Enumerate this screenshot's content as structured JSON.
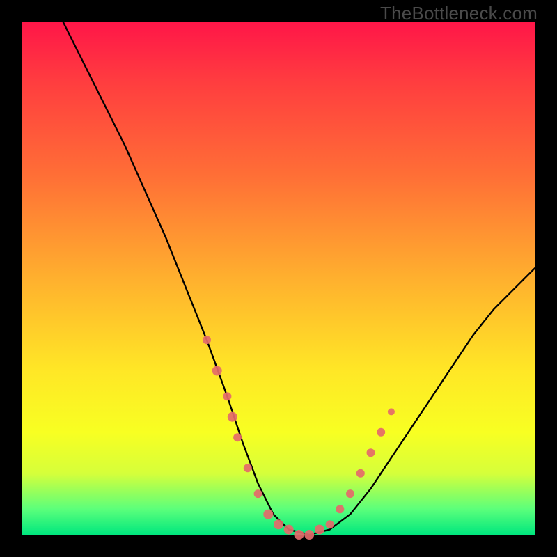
{
  "brand": "TheBottleneck.com",
  "chart_data": {
    "type": "line",
    "title": "",
    "xlabel": "",
    "ylabel": "",
    "xlim": [
      0,
      100
    ],
    "ylim": [
      0,
      100
    ],
    "series": [
      {
        "name": "bottleneck-curve",
        "x": [
          8,
          12,
          16,
          20,
          24,
          28,
          32,
          36,
          40,
          43,
          46,
          49,
          52,
          56,
          60,
          64,
          68,
          72,
          76,
          80,
          84,
          88,
          92,
          96,
          100
        ],
        "y_pct": [
          100,
          92,
          84,
          76,
          67,
          58,
          48,
          38,
          27,
          18,
          10,
          4,
          1,
          0,
          1,
          4,
          9,
          15,
          21,
          27,
          33,
          39,
          44,
          48,
          52
        ]
      }
    ],
    "markers": {
      "name": "highlighted-points",
      "color": "#e46a6a",
      "points": [
        {
          "x": 36,
          "y_pct": 38,
          "r": 6
        },
        {
          "x": 38,
          "y_pct": 32,
          "r": 7
        },
        {
          "x": 40,
          "y_pct": 27,
          "r": 6
        },
        {
          "x": 41,
          "y_pct": 23,
          "r": 7
        },
        {
          "x": 42,
          "y_pct": 19,
          "r": 6
        },
        {
          "x": 44,
          "y_pct": 13,
          "r": 6
        },
        {
          "x": 46,
          "y_pct": 8,
          "r": 6
        },
        {
          "x": 48,
          "y_pct": 4,
          "r": 7
        },
        {
          "x": 50,
          "y_pct": 2,
          "r": 7
        },
        {
          "x": 52,
          "y_pct": 1,
          "r": 7
        },
        {
          "x": 54,
          "y_pct": 0,
          "r": 7
        },
        {
          "x": 56,
          "y_pct": 0,
          "r": 7
        },
        {
          "x": 58,
          "y_pct": 1,
          "r": 7
        },
        {
          "x": 60,
          "y_pct": 2,
          "r": 6
        },
        {
          "x": 62,
          "y_pct": 5,
          "r": 6
        },
        {
          "x": 64,
          "y_pct": 8,
          "r": 6
        },
        {
          "x": 66,
          "y_pct": 12,
          "r": 6
        },
        {
          "x": 68,
          "y_pct": 16,
          "r": 6
        },
        {
          "x": 70,
          "y_pct": 20,
          "r": 6
        },
        {
          "x": 72,
          "y_pct": 24,
          "r": 5
        }
      ]
    },
    "bottom_band": {
      "from_pct": 0,
      "to_pct": 3.5,
      "color": "#00e77e"
    }
  }
}
